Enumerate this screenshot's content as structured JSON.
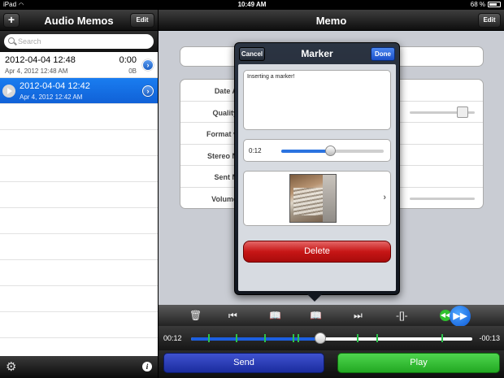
{
  "status_bar": {
    "device": "iPad",
    "time": "10:49 AM",
    "battery": "68 %"
  },
  "left_pane": {
    "title": "Audio Memos",
    "add_label": "+",
    "edit_label": "Edit",
    "search_placeholder": "Search",
    "memos": [
      {
        "name": "2012-04-04 12:48",
        "date": "Apr 4, 2012 12:48 AM",
        "duration": "0:00",
        "size": "0B",
        "selected": false
      },
      {
        "name": "2012-04-04 12:42",
        "date": "Apr 4, 2012 12:42 AM",
        "duration": "",
        "size": "",
        "selected": true
      }
    ]
  },
  "right_pane": {
    "title": "Memo",
    "edit_label": "Edit",
    "detail_labels": [
      "Date A",
      "Quality",
      "Format v",
      "Stereo N",
      "Sent N",
      "Volume"
    ],
    "timeline": {
      "elapsed": "00:12",
      "remaining": "-00:13",
      "progress": 0.46
    },
    "send_label": "Send",
    "play_label": "Play"
  },
  "marker_popover": {
    "title": "Marker",
    "cancel_label": "Cancel",
    "done_label": "Done",
    "note_text": "Inserting a marker!",
    "time_label": "0:12",
    "slider_value": 0.48,
    "delete_label": "Delete"
  },
  "colors": {
    "selection_blue": "#1a7df0",
    "send_blue": "#2b3fc0",
    "play_green": "#34c034",
    "delete_red": "#c71616"
  }
}
